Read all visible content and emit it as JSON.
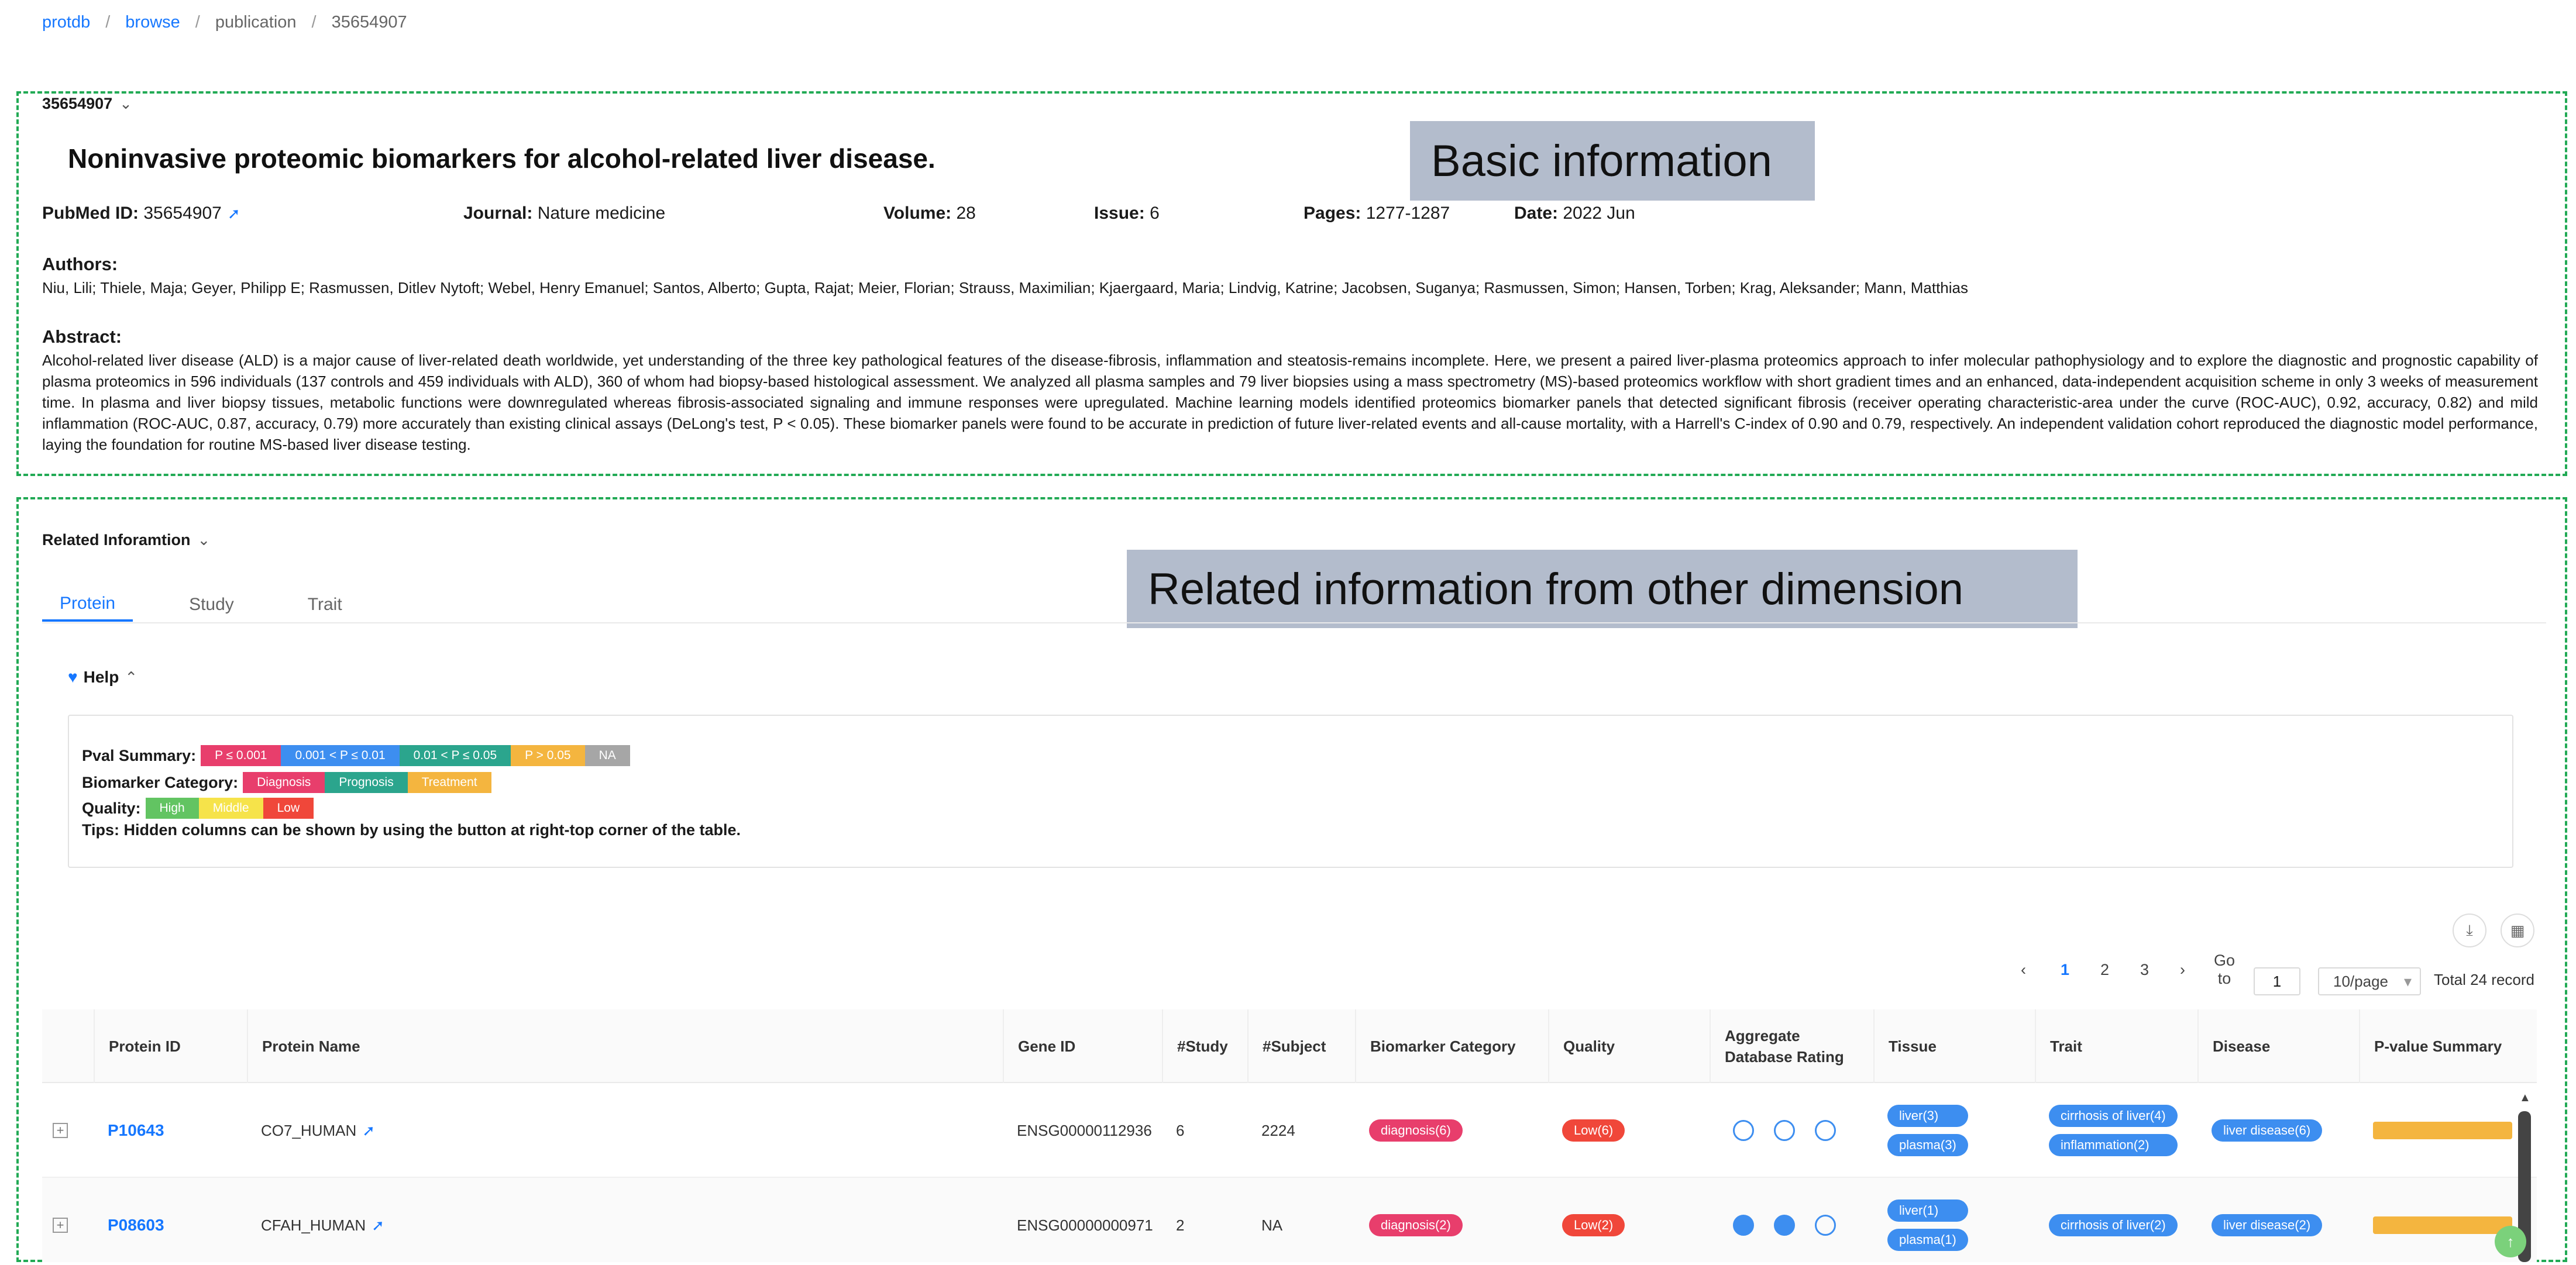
{
  "breadcrumb": [
    "protdb",
    "browse",
    "publication",
    "35654907"
  ],
  "basic": {
    "section_id": "35654907",
    "title": "Noninvasive proteomic biomarkers for alcohol-related liver disease.",
    "callout": "Basic information",
    "pubmed_label": "PubMed ID:",
    "pubmed_value": "35654907",
    "journal_label": "Journal:",
    "journal_value": "Nature medicine",
    "volume_label": "Volume:",
    "volume_value": "28",
    "issue_label": "Issue:",
    "issue_value": "6",
    "pages_label": "Pages:",
    "pages_value": "1277-1287",
    "date_label": "Date:",
    "date_value": "2022 Jun",
    "authors_label": "Authors:",
    "authors": "Niu, Lili; Thiele, Maja; Geyer, Philipp E; Rasmussen, Ditlev Nytoft; Webel, Henry Emanuel; Santos, Alberto; Gupta, Rajat; Meier, Florian; Strauss, Maximilian; Kjaergaard, Maria; Lindvig, Katrine; Jacobsen, Suganya; Rasmussen, Simon; Hansen, Torben; Krag, Aleksander; Mann, Matthias",
    "abstract_label": "Abstract:",
    "abstract": "Alcohol-related liver disease (ALD) is a major cause of liver-related death worldwide, yet understanding of the three key pathological features of the disease-fibrosis, inflammation and steatosis-remains incomplete. Here, we present a paired liver-plasma proteomics approach to infer molecular pathophysiology and to explore the diagnostic and prognostic capability of plasma proteomics in 596 individuals (137 controls and 459 individuals with ALD), 360 of whom had biopsy-based histological assessment. We analyzed all plasma samples and 79 liver biopsies using a mass spectrometry (MS)-based proteomics workflow with short gradient times and an enhanced, data-independent acquisition scheme in only 3 weeks of measurement time. In plasma and liver biopsy tissues, metabolic functions were downregulated whereas fibrosis-associated signaling and immune responses were upregulated. Machine learning models identified proteomics biomarker panels that detected significant fibrosis (receiver operating characteristic-area under the curve (ROC-AUC), 0.92, accuracy, 0.82) and mild inflammation (ROC-AUC, 0.87, accuracy, 0.79) more accurately than existing clinical assays (DeLong's test, P < 0.05). These biomarker panels were found to be accurate in prediction of future liver-related events and all-cause mortality, with a Harrell's C-index of 0.90 and 0.79, respectively. An independent validation cohort reproduced the diagnostic model performance, laying the foundation for routine MS-based liver disease testing."
  },
  "related": {
    "section_title": "Related Inforamtion",
    "callout": "Related information from other dimension",
    "tabs": [
      "Protein",
      "Study",
      "Trait"
    ],
    "help_label": "Help",
    "pval_label": "Pval Summary:",
    "pval_items": [
      {
        "text": "P ≤ 0.001",
        "color": "#e83e6c"
      },
      {
        "text": "0.001 < P ≤ 0.01",
        "color": "#3d8ef0"
      },
      {
        "text": "0.01 < P ≤ 0.05",
        "color": "#2ba58d"
      },
      {
        "text": "P > 0.05",
        "color": "#f4b53f"
      },
      {
        "text": "NA",
        "color": "#a6a6a6"
      }
    ],
    "category_label": "Biomarker Category:",
    "category_items": [
      {
        "text": "Diagnosis",
        "color": "#e83e6c"
      },
      {
        "text": "Prognosis",
        "color": "#2ba58d"
      },
      {
        "text": "Treatment",
        "color": "#f4b53f"
      }
    ],
    "quality_label": "Quality:",
    "quality_items": [
      {
        "text": "High",
        "color": "#62c462"
      },
      {
        "text": "Middle",
        "color": "#f6e34a"
      },
      {
        "text": "Low",
        "color": "#f0473a"
      }
    ],
    "tips": "Tips: Hidden columns can be shown by using the button at right-top corner of the table.",
    "pagination": {
      "pages": [
        "1",
        "2",
        "3"
      ],
      "current": "1",
      "goto_label": "Go to",
      "goto_value": "1",
      "page_size": "10/page",
      "total": "Total 24 record"
    },
    "columns": [
      "Protein ID",
      "Protein Name",
      "Gene ID",
      "#Study",
      "#Subject",
      "Biomarker Category",
      "Quality",
      "Aggregate Database Rating",
      "Tissue",
      "Trait",
      "Disease",
      "P-value Summary"
    ],
    "rows": [
      {
        "protein_id": "P10643",
        "protein_name": "CO7_HUMAN",
        "gene_id": "ENSG00000112936",
        "study": "6",
        "subject": "2224",
        "category": "diagnosis(6)",
        "quality": "Low(6)",
        "rating_filled": 0,
        "tissue": [
          "liver(3)",
          "plasma(3)"
        ],
        "trait": [
          "cirrhosis of liver(4)",
          "inflammation(2)"
        ],
        "disease": "liver disease(6)",
        "pval_color": "#f4b53f"
      },
      {
        "protein_id": "P08603",
        "protein_name": "CFAH_HUMAN",
        "gene_id": "ENSG00000000971",
        "study": "2",
        "subject": "NA",
        "category": "diagnosis(2)",
        "quality": "Low(2)",
        "rating_filled": 2,
        "tissue": [
          "liver(1)",
          "plasma(1)"
        ],
        "trait": [
          "cirrhosis of liver(2)"
        ],
        "disease": "liver disease(2)",
        "pval_color": "#f4b53f"
      }
    ]
  },
  "colors": {
    "accent": "#1677ff",
    "tag_blue": "#3d8ef0",
    "diagnosis": "#e83e6c",
    "low": "#f0473a",
    "dashed_border": "#22aa55",
    "callout_bg": "#b3bccc"
  },
  "icons": {
    "external": "external-link-icon",
    "chevron": "chevron-down-icon",
    "help": "heart-icon",
    "download": "download-icon",
    "columns": "column-settings-icon",
    "expand": "expand-row-icon",
    "back_top": "back-to-top-icon"
  }
}
